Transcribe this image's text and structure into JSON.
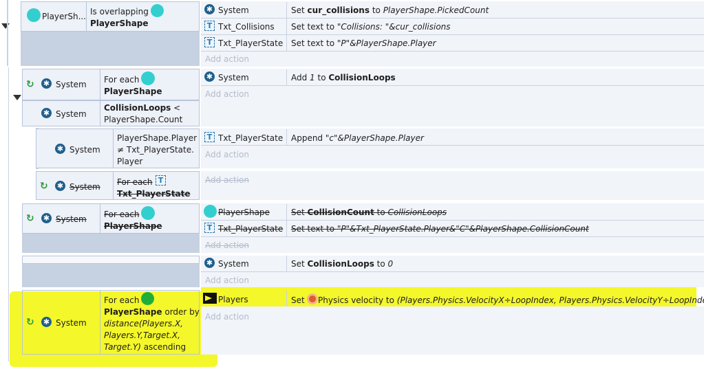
{
  "b1": {
    "obj": "PlayerSh...",
    "c1": "Is overlapping",
    "c2": "PlayerShape",
    "a1o": "System",
    "a1p": "Set ",
    "a1b": "cur_collisions",
    "a1q": " to ",
    "a1r": "PlayerShape.PickedCount",
    "a2o": "Txt_Collisions",
    "a2p": "Set text to ",
    "a2r": "\"Collisions: \"&cur_collisions",
    "a3o": "Txt_PlayerState",
    "a3p": "Set text to ",
    "a3r": "\"P\"&PlayerShape.Player",
    "add": "Add action"
  },
  "b2": {
    "sys1": "System",
    "fe": "For each ",
    "fo": "PlayerShape",
    "sys2": "System",
    "cl": "CollisionLoops",
    "lt": " <",
    "cnt": "PlayerShape.Count",
    "a1o": "System",
    "a1p": "Add ",
    "a1n": "1",
    "a1q": " to ",
    "a1b": "CollisionLoops",
    "add": "Add action"
  },
  "b3": {
    "sys": "System",
    "l1": "PlayerShape.Player",
    "l2": "≠ Txt_PlayerState.",
    "l3": "Player",
    "a1o": "Txt_PlayerState",
    "a1p": "Append ",
    "a1r": "\"c\"&PlayerShape.Player",
    "add": "Add action"
  },
  "b4": {
    "sys": "System",
    "fe": "For each ",
    "fo": "Txt_PlayerState",
    "add": "Add action"
  },
  "b5": {
    "sys": "System",
    "fe": "For each ",
    "fo": "PlayerShape",
    "a1o": "PlayerShape",
    "a1p": "Set ",
    "a1b": "CollisionCount",
    "a1q": " to ",
    "a1r": "CollisionLoops",
    "a2o": "Txt_PlayerState",
    "a2p": "Set text to ",
    "a2r": "\"P\"&Txt_PlayerState.Player&\"C\"&PlayerShape.CollisionCount",
    "add": "Add action"
  },
  "b6": {
    "a1o": "System",
    "a1p": "Set ",
    "a1b": "CollisionLoops",
    "a1q": " to ",
    "a1r": "0",
    "add": "Add action"
  },
  "b7": {
    "sys": "System",
    "fe": "For each ",
    "fo": "PlayerShape",
    "ob": " order by",
    "l3": "distance(Players.X,",
    "l4": "Players.Y,Target.X,",
    "l5": "Target.Y)",
    "asc": " ascending",
    "a1o": "Players",
    "a1p": "Set ",
    "a1q": " Physics velocity to ",
    "a1r": "(Players.Physics.VelocityX÷LoopIndex, Players.Physics.VelocityY÷LoopIndex)",
    "add": "Add action"
  }
}
